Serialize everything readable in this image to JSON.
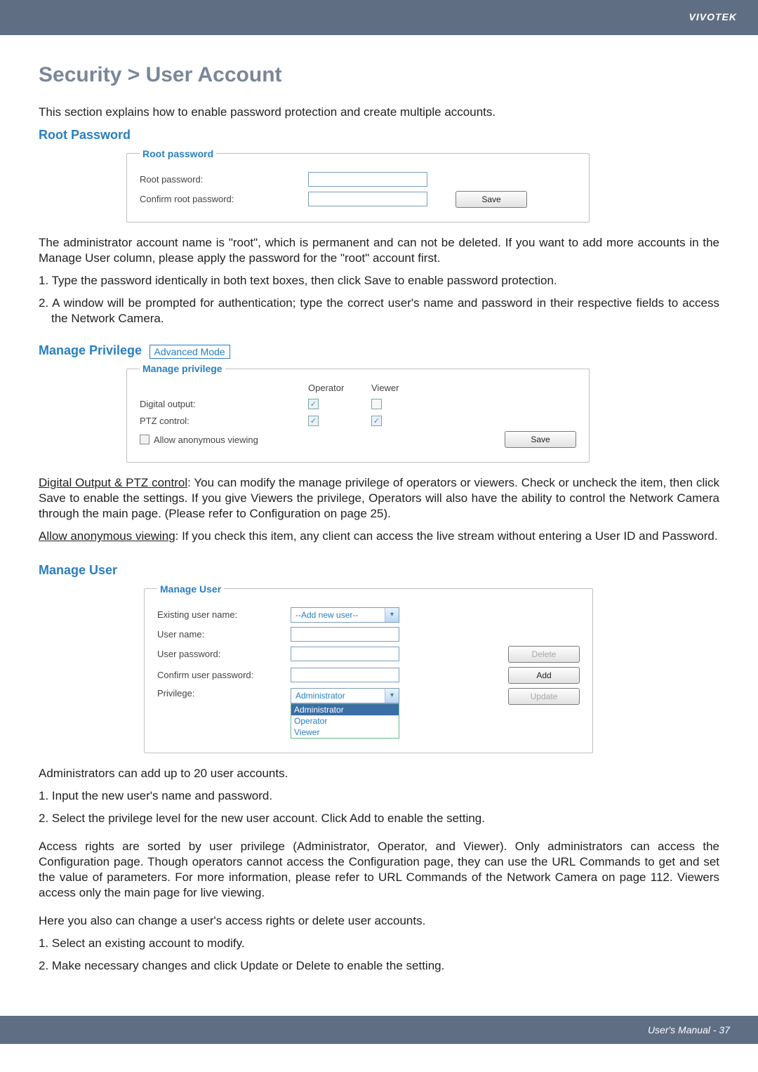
{
  "brand": "VIVOTEK",
  "title": "Security > User Account",
  "intro": "This section explains how to enable password protection and create multiple accounts.",
  "root_password": {
    "heading": "Root Password",
    "legend": "Root password",
    "label_pw": "Root password:",
    "label_confirm": "Confirm root password:",
    "save_btn": "Save"
  },
  "root_text": {
    "p1": "The administrator account name is \"root\", which is permanent and can not be deleted. If you want to add more accounts in the Manage User column, please apply the password for the \"root\" account first.",
    "s1": "1. Type the password identically in both text boxes, then click Save to enable password protection.",
    "s2": "2. A window will be prompted for authentication; type the correct user's name and password in their respective fields to access the Network Camera."
  },
  "manage_privilege": {
    "heading": "Manage Privilege",
    "badge": "Advanced Mode",
    "legend": "Manage privilege",
    "col_operator": "Operator",
    "col_viewer": "Viewer",
    "row_do": "Digital output:",
    "row_ptz": "PTZ control:",
    "row_anon": "Allow anonymous viewing",
    "save_btn": "Save",
    "checks": {
      "do_op": true,
      "do_vw": false,
      "ptz_op": true,
      "ptz_vw": true,
      "anon": false
    }
  },
  "priv_text": {
    "p1_label": "Digital Output & PTZ control",
    "p1_rest": ": You can modify the manage privilege of operators or viewers. Check or uncheck the item, then click Save to enable the settings. If you give Viewers the privilege, Operators will also have the ability to control the Network Camera through the main page. (Please refer to Configuration on page 25).",
    "p2_label": "Allow anonymous viewing",
    "p2_rest": ": If you check this item, any client can access the live stream without entering a User ID and Password."
  },
  "manage_user": {
    "heading": "Manage User",
    "legend": "Manage User",
    "label_existing": "Existing user name:",
    "sel_existing": "--Add new user--",
    "label_uname": "User name:",
    "label_upw": "User password:",
    "label_cpw": "Confirm user password:",
    "label_priv": "Privilege:",
    "sel_priv": "Administrator",
    "opts": [
      "Administrator",
      "Operator",
      "Viewer"
    ],
    "btn_delete": "Delete",
    "btn_add": "Add",
    "btn_update": "Update"
  },
  "mu_text": {
    "intro": "Administrators can add up to 20 user accounts.",
    "s1": "1. Input the new user's name and password.",
    "s2": "2. Select the privilege level for the new user account. Click Add to enable the setting.",
    "p_access": "Access rights are sorted by user privilege (Administrator, Operator, and Viewer). Only administrators can access the Configuration page. Though operators cannot access the Configuration page, they can use the URL Commands to get and set the value of parameters. For more information, please refer to URL Commands of the Network Camera on page 112. Viewers access only the main page for live viewing.",
    "p_change": "Here you also can change a user's access rights or delete user accounts.",
    "c1": "1. Select an existing account to modify.",
    "c2": "2. Make necessary changes and click Update or Delete to enable the setting."
  },
  "footer": "User's Manual - 37"
}
